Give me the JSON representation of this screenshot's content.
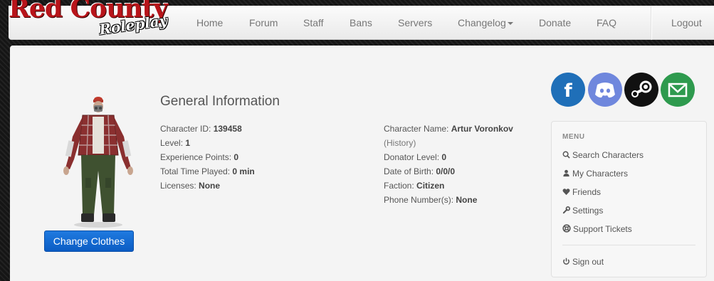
{
  "brand": {
    "line1": "Red County",
    "line2": "Roleplay"
  },
  "nav": {
    "home": "Home",
    "forum": "Forum",
    "staff": "Staff",
    "bans": "Bans",
    "servers": "Servers",
    "changelog": "Changelog",
    "donate": "Donate",
    "faq": "FAQ",
    "logout": "Logout"
  },
  "character": {
    "change_clothes": "Change Clothes",
    "section_title": "General Information",
    "left": [
      {
        "label": "Character ID:",
        "value": "139458"
      },
      {
        "label": "Level:",
        "value": "1"
      },
      {
        "label": "Experience Points:",
        "value": "0"
      },
      {
        "label": "Total Time Played:",
        "value": "0 min"
      },
      {
        "label": "Licenses:",
        "value": "None"
      }
    ],
    "right": {
      "name_label": "Character Name:",
      "name_value": "Artur Voronkov",
      "history": "(History)",
      "donator_label": "Donator Level:",
      "donator_value": "0",
      "dob_label": "Date of Birth:",
      "dob_value": "0/0/0",
      "faction_label": "Faction:",
      "faction_value": "Citizen",
      "phone_label": "Phone Number(s):",
      "phone_value": "None"
    }
  },
  "social": [
    {
      "name": "facebook-icon",
      "color": "#1f6fb8"
    },
    {
      "name": "discord-icon",
      "color": "#6f87dd"
    },
    {
      "name": "steam-icon",
      "color": "#111111"
    },
    {
      "name": "email-icon",
      "color": "#2e9a4e"
    }
  ],
  "menu": {
    "heading": "MENU",
    "search": "Search Characters",
    "my_characters": "My Characters",
    "friends": "Friends",
    "settings": "Settings",
    "support": "Support Tickets",
    "sign_out": "Sign out"
  }
}
